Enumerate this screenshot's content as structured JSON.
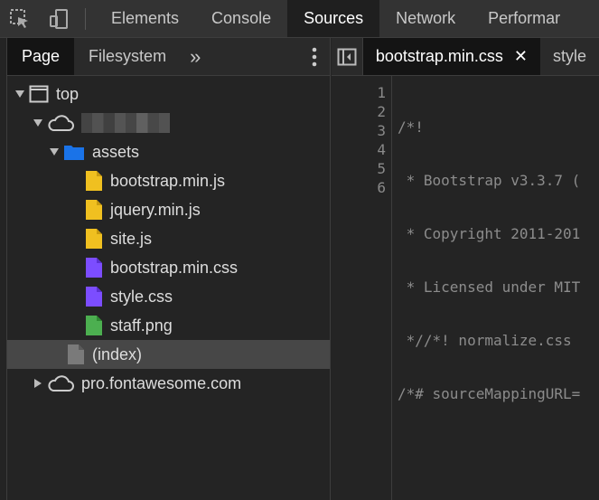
{
  "toolbar": {
    "tabs": [
      {
        "label": "Elements",
        "active": false
      },
      {
        "label": "Console",
        "active": false
      },
      {
        "label": "Sources",
        "active": true
      },
      {
        "label": "Network",
        "active": false
      },
      {
        "label": "Performar",
        "active": false
      }
    ],
    "icons": [
      "inspect-element-icon",
      "device-toolbar-icon"
    ]
  },
  "navigator": {
    "tabs": [
      {
        "label": "Page",
        "active": true
      },
      {
        "label": "Filesystem",
        "active": false
      }
    ],
    "more_label": "»",
    "tree": {
      "top": "top",
      "hidden_domain_redacted": true,
      "assets_folder": "assets",
      "files": [
        {
          "name": "bootstrap.min.js",
          "type": "script",
          "color": "#f0c020"
        },
        {
          "name": "jquery.min.js",
          "type": "script",
          "color": "#f0c020"
        },
        {
          "name": "site.js",
          "type": "script",
          "color": "#f0c020"
        },
        {
          "name": "bootstrap.min.css",
          "type": "stylesheet",
          "color": "#7c4dff"
        },
        {
          "name": "style.css",
          "type": "stylesheet",
          "color": "#7c4dff"
        },
        {
          "name": "staff.png",
          "type": "image",
          "color": "#4caf50"
        }
      ],
      "index": "(index)",
      "other_domain": "pro.fontawesome.com"
    }
  },
  "editor": {
    "tabs": [
      {
        "label": "bootstrap.min.css",
        "active": true,
        "closable": true
      },
      {
        "label": "style",
        "active": false
      }
    ],
    "lines": [
      {
        "n": "1",
        "text": "/*!"
      },
      {
        "n": "2",
        "text": " * Bootstrap v3.3.7 ("
      },
      {
        "n": "3",
        "text": " * Copyright 2011-201"
      },
      {
        "n": "4",
        "text": " * Licensed under MIT"
      },
      {
        "n": "5",
        "text": " *//*! normalize.css "
      },
      {
        "n": "6",
        "text": "/*# sourceMappingURL="
      }
    ]
  },
  "colors": {
    "folder": "#1a73e8",
    "document": "#7a7a7a",
    "selected_row": "#474747"
  }
}
